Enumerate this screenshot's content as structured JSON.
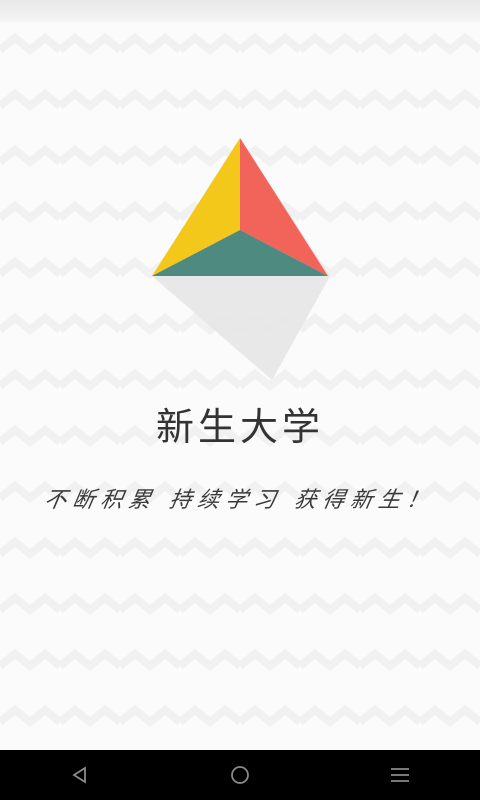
{
  "app": {
    "title": "新生大学",
    "slogan": "不断积累 持续学习 获得新生！"
  },
  "logo": {
    "icon": "triangle-logo",
    "colors": {
      "left_face": "#f4c81b",
      "right_face": "#f2645a",
      "bottom_face": "#4e8a80",
      "shadow": "#e6e6e6"
    }
  },
  "navigation": {
    "back_icon": "back-triangle-icon",
    "home_icon": "home-circle-icon",
    "menu_icon": "menu-lines-icon"
  },
  "colors": {
    "background": "#fbfbfb",
    "nav_bar": "#000000",
    "nav_icon": "#8a8a8a"
  }
}
